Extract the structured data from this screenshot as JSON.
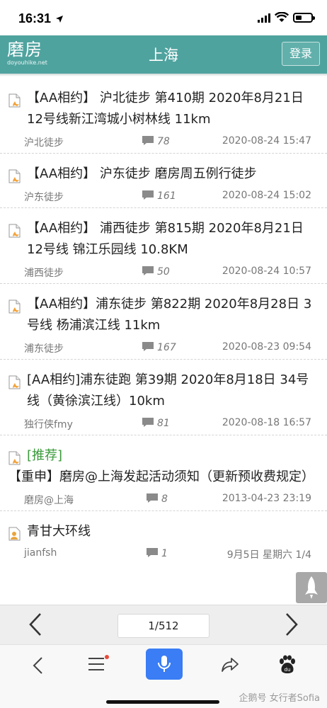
{
  "status_bar": {
    "time": "16:31"
  },
  "header": {
    "logo_text": "磨房",
    "logo_sub": "doyouhike.net",
    "title": "上海",
    "login_label": "登录"
  },
  "posts": [
    {
      "title": "【AA相约】 沪北徒步 第410期 2020年8月21日 12号线新江湾城小树林线 11km",
      "author": "沪北徒步",
      "comments": "78",
      "date": "2020-08-24 15:47",
      "icon": "document-icon"
    },
    {
      "title": "【AA相约】 沪东徒步 磨房周五例行徒步",
      "author": "沪东徒步",
      "comments": "161",
      "date": "2020-08-24 15:02",
      "icon": "document-icon"
    },
    {
      "title": "【AA相约】 浦西徒步 第815期 2020年8月21日 12号线 锦江乐园线 10.8KM",
      "author": "浦西徒步",
      "comments": "50",
      "date": "2020-08-24 10:57",
      "icon": "document-icon"
    },
    {
      "title": "【AA相约】浦东徒步 第822期 2020年8月28日 3号线 杨浦滨江线 11km",
      "author": "浦东徒步",
      "comments": "167",
      "date": "2020-08-23 09:54",
      "icon": "document-icon"
    },
    {
      "title": "[AA相约]浦东徒跑 第39期 2020年8月18日 34号线（黄徐滨江线）10km",
      "author": "独行侠fmy",
      "comments": "81",
      "date": "2020-08-18 16:57",
      "icon": "document-icon"
    },
    {
      "tag": "[推荐]",
      "title": "【重申】磨房@上海发起活动须知（更新预收费规定）",
      "author": "磨房@上海",
      "comments": "8",
      "date": "2013-04-23 23:19",
      "icon": "document-icon"
    },
    {
      "title": "青甘大环线",
      "author": "jianfsh",
      "comments": "1",
      "date": "9月5日 星期六 1/4",
      "icon": "user-document-icon"
    }
  ],
  "pager": {
    "page_label": "1/512"
  },
  "watermark": "企鹅号 女行者Sofia",
  "colors": {
    "header_bg": "#4fa39f",
    "voice_button": "#3a7df5",
    "recommend_tag": "#3a9a3a"
  }
}
